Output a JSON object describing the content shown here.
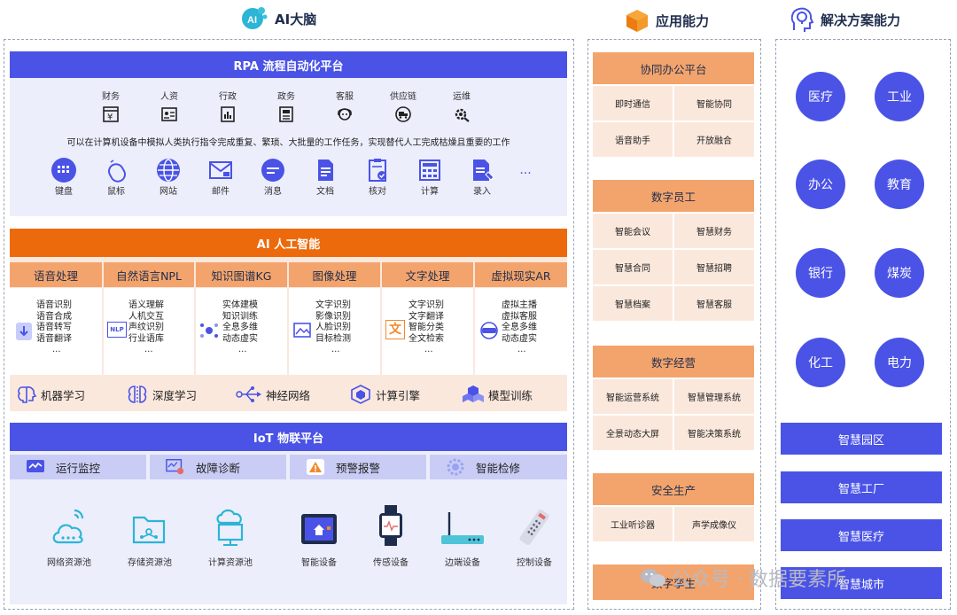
{
  "headers": {
    "ai_brain": "AI大脑",
    "app_capability": "应用能力",
    "solution_capability": "解决方案能力"
  },
  "rpa": {
    "title": "RPA 流程自动化平台",
    "departments": [
      "财务",
      "人资",
      "行政",
      "政务",
      "客服",
      "供应链",
      "运维"
    ],
    "description": "可以在计算机设备中模拟人类执行指令完成重复、繁琐、大批量的工作任务，实现替代人工完成枯燥且重要的工作",
    "flow": [
      "键盘",
      "鼠标",
      "网站",
      "邮件",
      "消息",
      "文档",
      "核对",
      "计算",
      "录入"
    ],
    "flow_more": "..."
  },
  "ai": {
    "title": "AI 人工智能",
    "columns": [
      {
        "title": "语音处理",
        "items": [
          "语音识别",
          "语音合成",
          "语音转写",
          "语音翻译",
          "..."
        ]
      },
      {
        "title": "自然语言NPL",
        "items": [
          "语义理解",
          "人机交互",
          "声纹识别",
          "行业语库",
          "..."
        ],
        "icon_text": "NLP"
      },
      {
        "title": "知识图谱KG",
        "items": [
          "实体建模",
          "知识训练",
          "全息多维",
          "动态虚实",
          "..."
        ]
      },
      {
        "title": "图像处理",
        "items": [
          "文字识别",
          "影像识别",
          "人脸识别",
          "目标检测",
          "..."
        ]
      },
      {
        "title": "文字处理",
        "items": [
          "文字识别",
          "文字翻译",
          "智能分类",
          "全文检索",
          "..."
        ],
        "icon_text": "文"
      },
      {
        "title": "虚拟现实AR",
        "items": [
          "虚拟主播",
          "虚拟客服",
          "全息多维",
          "动态虚实",
          "..."
        ]
      }
    ],
    "ml": [
      "机器学习",
      "深度学习",
      "神经网络",
      "计算引擎",
      "模型训练"
    ]
  },
  "iot": {
    "title": "IoT 物联平台",
    "tabs": [
      "运行监控",
      "故障诊断",
      "预警报警",
      "智能检修"
    ],
    "devices": [
      "网络资源池",
      "存储资源池",
      "计算资源池",
      "智能设备",
      "传感设备",
      "边端设备",
      "控制设备"
    ]
  },
  "app": {
    "groups": [
      {
        "title": "协同办公平台",
        "cells": [
          "即时通信",
          "智能协同",
          "语音助手",
          "开放融合"
        ]
      },
      {
        "title": "数字员工",
        "cells": [
          "智能会议",
          "智慧财务",
          "智慧合同",
          "智慧招聘",
          "智慧档案",
          "智慧客服"
        ]
      },
      {
        "title": "数字经营",
        "cells": [
          "智能运营系统",
          "智慧管理系统",
          "全景动态大屏",
          "智能决策系统"
        ]
      },
      {
        "title": "安全生产",
        "cells": [
          "工业听诊器",
          "声学成像仪"
        ]
      },
      {
        "title": "数字孪生",
        "cells": []
      }
    ]
  },
  "solutions": {
    "industries": [
      "医疗",
      "工业",
      "办公",
      "教育",
      "银行",
      "煤炭",
      "化工",
      "电力"
    ],
    "smart": [
      "智慧园区",
      "智慧工厂",
      "智慧医疗",
      "智慧城市"
    ]
  },
  "watermark": "公众号 · 数据要素所",
  "colors": {
    "blue": "#4a53e6",
    "orange": "#ec6a0b",
    "light_orange": "#f3a46c",
    "peach": "#fbe8dd",
    "lavender": "#eceefb"
  }
}
